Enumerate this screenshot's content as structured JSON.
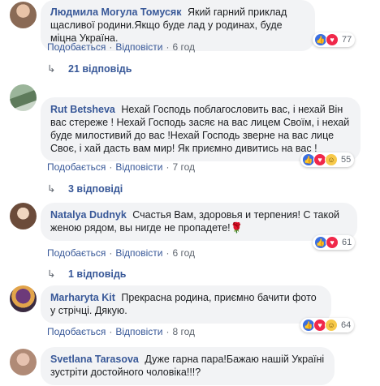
{
  "action_like": "Подобається",
  "action_reply": "Відповісти",
  "comments": [
    {
      "author": "Людмила Могула Томусяк",
      "text": "Який гарний приклад щасливої родини.Якщо буде лад у родинах, буде міцна Україна.",
      "time": "6 год",
      "reaction_count": "77",
      "replies": "21 відповідь"
    },
    {
      "author": "Rut Betsheva",
      "text": "Нехай Господь поблагословить вас, і нехай Він вас стереже ! Нехай Господь засяє на вас лицем Своїм, і нехай буде милостивий до вас !Нехай Господь зверне на вас лице Своє, і хай дасть вам мир! Як приємно дивитись на вас !",
      "time": "7 год",
      "reaction_count": "55",
      "replies": "3 відповіді"
    },
    {
      "author": "Natalya Dudnyk",
      "text": "Счастья Вам, здоровья и терпения! С такой женою рядом, вы нигде не пропадете!🌹",
      "time": "6 год",
      "reaction_count": "61",
      "replies": "1 відповідь"
    },
    {
      "author": "Marharyta Kit",
      "text": "Прекрасна родина, приємно бачити фото у стрічці. Дякую.",
      "time": "8 год",
      "reaction_count": "64"
    },
    {
      "author": "Svetlana Tarasova",
      "text": "Дуже гарна пара!Бажаю нашій Україні зустріти достойного чоловіка!!!?"
    }
  ]
}
